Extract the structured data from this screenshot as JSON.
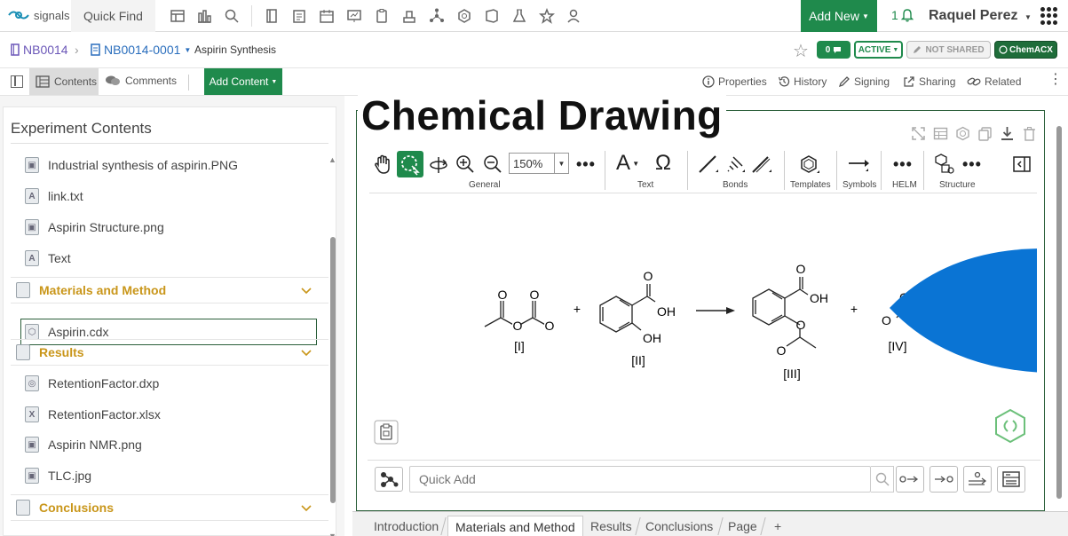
{
  "app": {
    "brand": "signals",
    "quick_find": "Quick Find",
    "add_new": "Add New",
    "notifications": "1",
    "user": "Raquel Perez"
  },
  "breadcrumb": {
    "notebook": "NB0014",
    "experiment": "NB0014-0001",
    "title": "Aspirin Synthesis"
  },
  "badges": {
    "comments_count": "0",
    "status": "ACTIVE",
    "sharing": "NOT SHARED",
    "chemacx": "ChemACX"
  },
  "toolbar": {
    "contents": "Contents",
    "comments": "Comments",
    "add_content": "Add Content",
    "properties": "Properties",
    "history": "History",
    "signing": "Signing",
    "sharing": "Sharing",
    "related": "Related"
  },
  "contents": {
    "title": "Experiment Contents",
    "items": [
      {
        "label": "Industrial synthesis of aspirin.PNG",
        "icon": "image-file-icon"
      },
      {
        "label": "link.txt",
        "icon": "text-file-icon"
      },
      {
        "label": "Aspirin Structure.png",
        "icon": "image-file-icon"
      },
      {
        "label": "Text",
        "icon": "text-file-icon"
      }
    ],
    "sections": [
      {
        "label": "Materials and Method",
        "items": [
          {
            "label": "Aspirin.cdx",
            "icon": "chemdraw-file-icon"
          }
        ]
      },
      {
        "label": "Results",
        "items": [
          {
            "label": "RetentionFactor.dxp",
            "icon": "spotfire-file-icon"
          },
          {
            "label": "RetentionFactor.xlsx",
            "icon": "excel-file-icon"
          },
          {
            "label": "Aspirin NMR.png",
            "icon": "image-file-icon"
          },
          {
            "label": "TLC.jpg",
            "icon": "image-file-icon"
          }
        ]
      },
      {
        "label": "Conclusions",
        "items": []
      }
    ]
  },
  "drawing": {
    "title": "Chemical Drawing",
    "zoom": "150%",
    "groups": [
      "General",
      "Text",
      "Bonds",
      "Templates",
      "Symbols",
      "HELM",
      "Structure"
    ],
    "compounds": [
      "[I]",
      "[II]",
      "[III]",
      "[IV]"
    ],
    "atoms": {
      "o": "O",
      "oh": "OH"
    },
    "plus": "+",
    "quick_add_placeholder": "Quick Add"
  },
  "tabs": [
    "Introduction",
    "Materials and Method",
    "Results",
    "Conclusions",
    "Page"
  ],
  "tabs_add": "+",
  "colors": {
    "accent_green": "#1f8a4c",
    "section_gold": "#c9961a",
    "link_blue": "#2a6ebd",
    "overlay_blue": "#0a74d4"
  }
}
